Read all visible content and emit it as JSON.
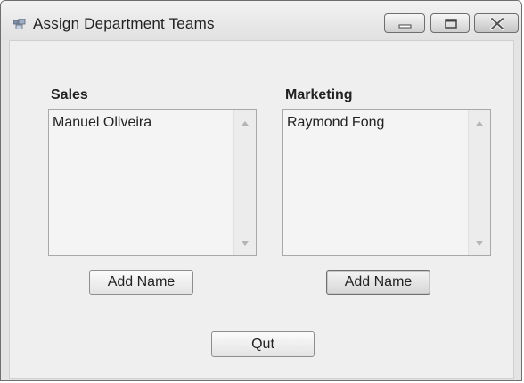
{
  "window": {
    "title": "Assign Department Teams",
    "controls": {
      "minimize": "minimize-icon",
      "maximize": "maximize-icon",
      "close": "close-icon"
    }
  },
  "sales": {
    "label": "Sales",
    "items": [
      "Manuel Oliveira"
    ],
    "add_button": "Add Name"
  },
  "marketing": {
    "label": "Marketing",
    "items": [
      "Raymond Fong"
    ],
    "add_button": "Add Name"
  },
  "quit_button": "Qut",
  "colors": {
    "window_bg": "#efefef",
    "frame": "#e4e4e4",
    "text": "#222222"
  }
}
